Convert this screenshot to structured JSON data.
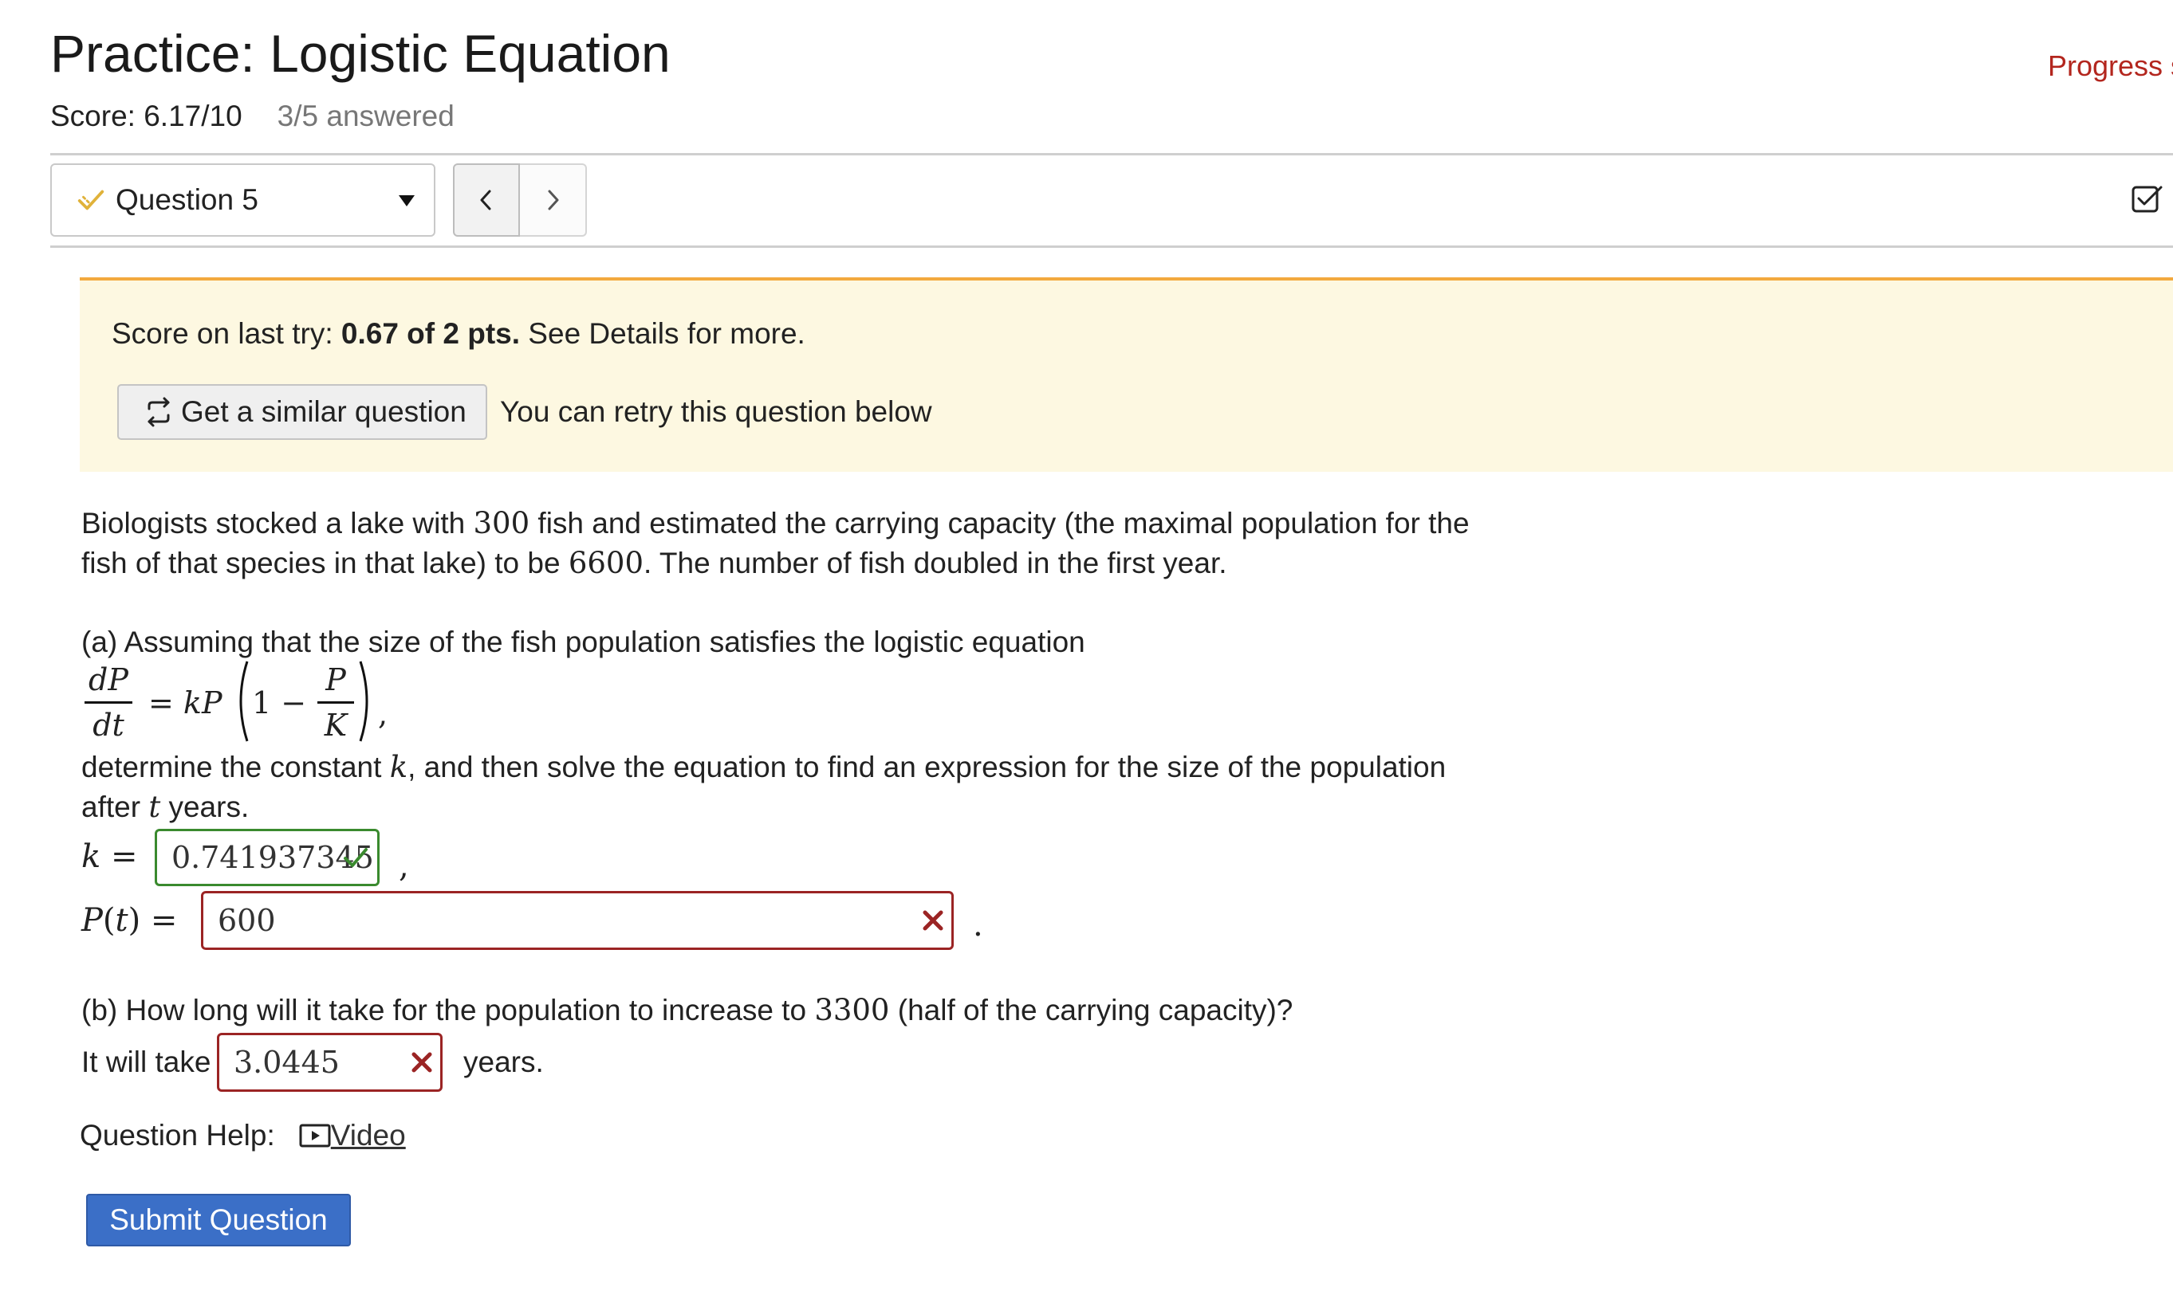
{
  "header": {
    "title": "Practice: Logistic Equation",
    "progress_link": "Progress s",
    "score": "Score: 6.17/10",
    "answered": "3/5 answered"
  },
  "question_nav": {
    "selected": "Question 5",
    "prev_icon": "chevron-left-icon",
    "next_icon": "chevron-right-icon"
  },
  "banner": {
    "score_prefix": "Score on last try: ",
    "score_bold": "0.67 of 2 pts.",
    "score_suffix": " See Details for more.",
    "similar_button": "Get a similar question",
    "retry_text": "You can retry this question below"
  },
  "problem": {
    "line1_a": "Biologists stocked a lake with ",
    "line1_n1": "300",
    "line1_b": " fish and estimated the carrying capacity (the maximal population for the",
    "line2_a": "fish of that species in that lake) to be ",
    "line2_n": "6600",
    "line2_b": ". The number of fish doubled in the first year.",
    "part_a_intro": "(a) Assuming that the size of the fish population satisfies the logistic equation",
    "eq_dp": "dP",
    "eq_dt": "dt",
    "eq_mid": "= kP",
    "eq_one": "1 −",
    "eq_p": "P",
    "eq_k": "K",
    "eq_end": ",",
    "det_a": "determine the constant ",
    "det_k": "k",
    "det_b": ", and then solve the equation to find an expression for the size of the population",
    "after_a": "after ",
    "after_t": "t",
    "after_b": " years.",
    "k_label": "k =",
    "k_value": "0.741937345",
    "k_comma": ",",
    "p_label": "P(t) =",
    "p_value": "600",
    "p_period": ".",
    "part_b_a": "(b) How long will it take for the population to increase to ",
    "part_b_n": "3300",
    "part_b_b": " (half of the carrying capacity)?",
    "take_label": "It will take",
    "take_value": "3.0445",
    "years": "years."
  },
  "help": {
    "label": "Question Help:",
    "video": "Video"
  },
  "submit": "Submit Question",
  "colors": {
    "accent": "#3b6fc7",
    "banner_bg": "#fdf8e1",
    "banner_border": "#f3a93e",
    "correct": "#3a8a2e",
    "wrong": "#9b2424",
    "progress": "#b3261e"
  }
}
